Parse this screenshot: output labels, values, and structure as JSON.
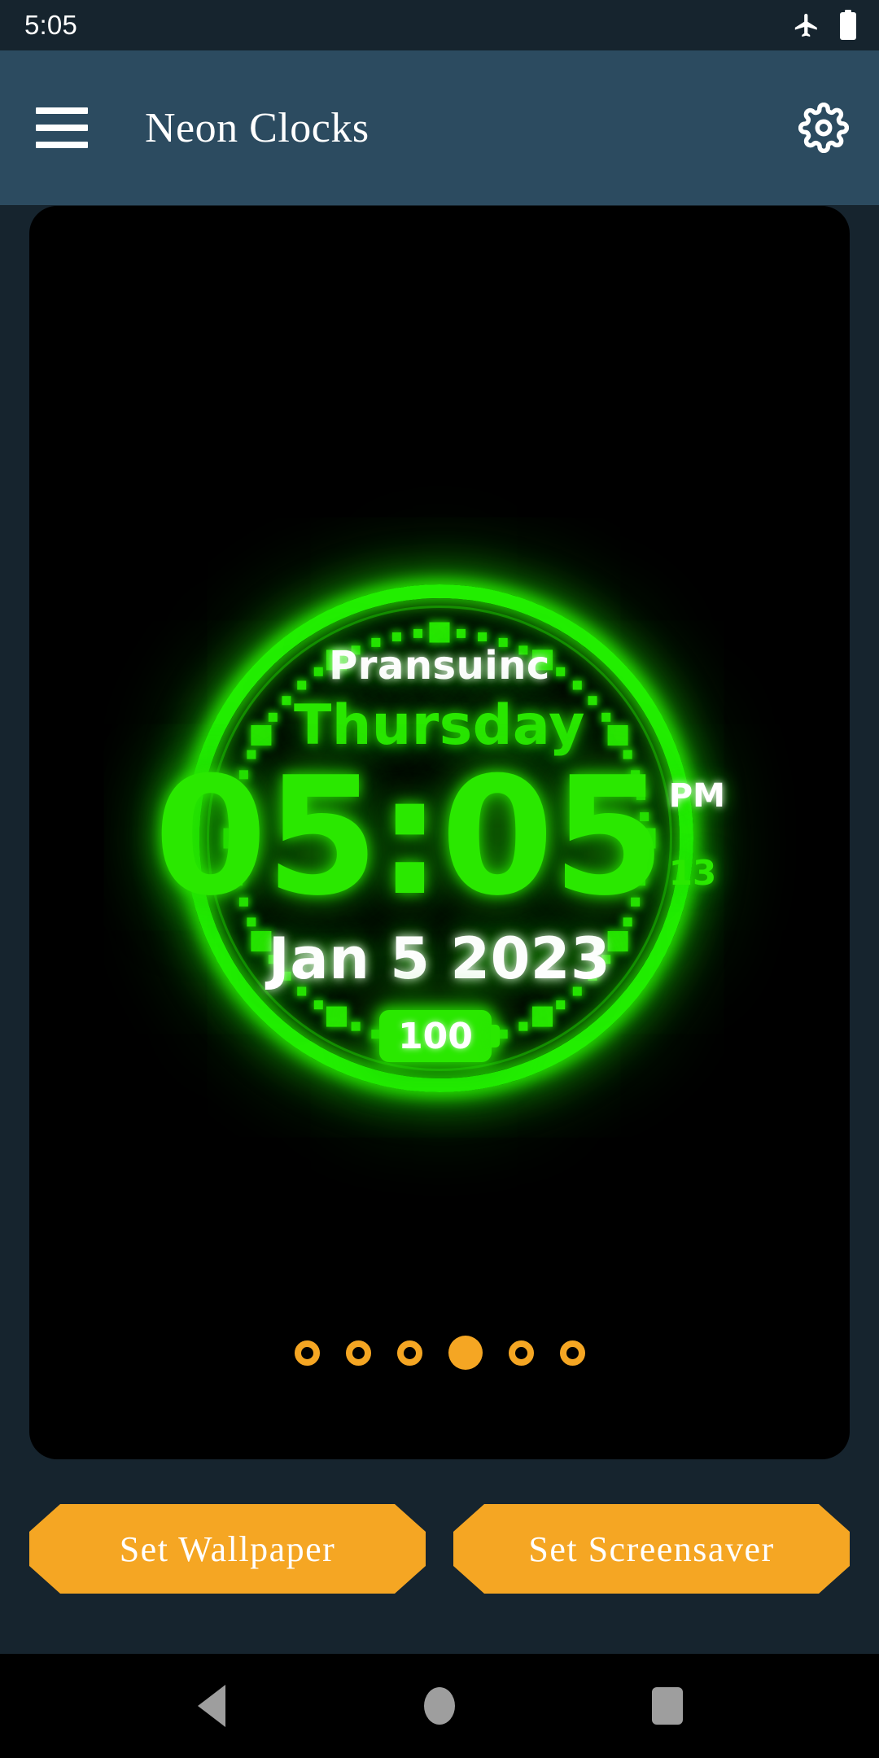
{
  "status_bar": {
    "time": "5:05",
    "icons": [
      "airplane-mode-icon",
      "battery-full-icon"
    ]
  },
  "app_bar": {
    "menu_icon": "hamburger-menu-icon",
    "title": "Neon Clocks",
    "settings_icon": "gear-icon",
    "background_color": "#2c4b60"
  },
  "clock": {
    "brand": "Pransuinc",
    "weekday": "Thursday",
    "time": "05:05",
    "meridiem": "PM",
    "seconds": "13",
    "date": "Jan 5 2023",
    "battery_level": "100",
    "neon_color": "#2ae800",
    "card_background": "#000000"
  },
  "page_indicator": {
    "total": 6,
    "active_index": 3,
    "color": "#f5a623"
  },
  "actions": {
    "set_wallpaper_label": "Set Wallpaper",
    "set_screensaver_label": "Set Screensaver",
    "button_color": "#f5a623"
  },
  "nav_bar": {
    "back_label": "Back",
    "home_label": "Home",
    "recents_label": "Recents",
    "icon_color": "#9e9e9e"
  }
}
